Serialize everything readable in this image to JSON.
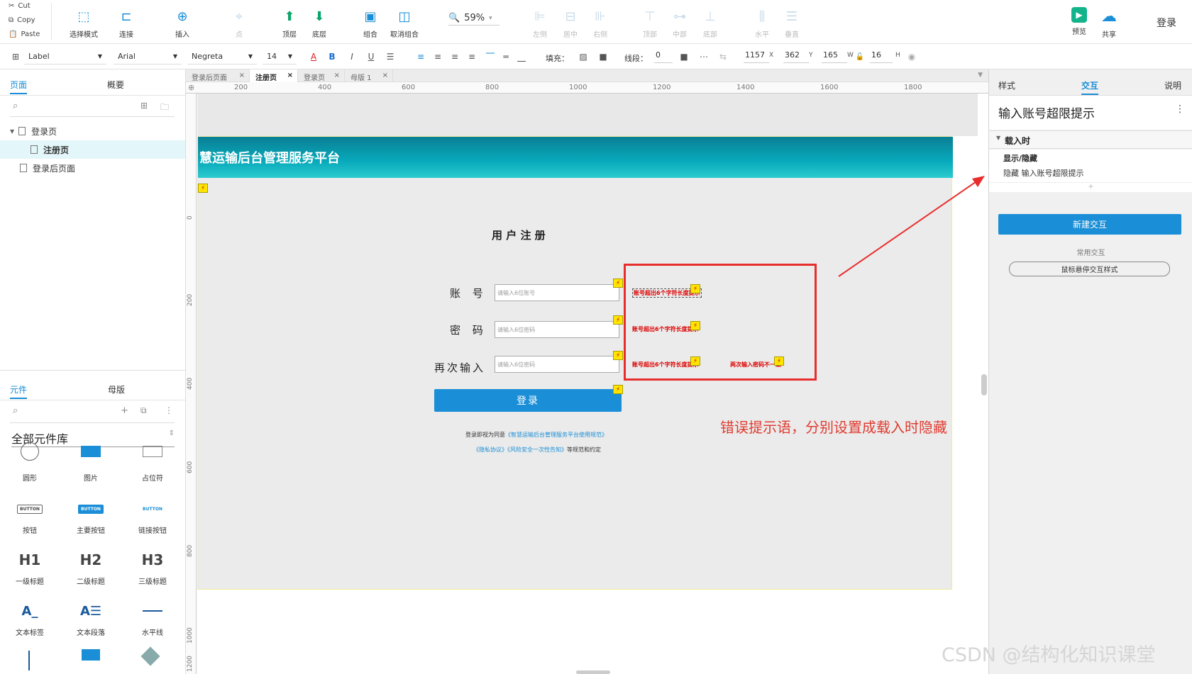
{
  "clipboard": {
    "cut": "Cut",
    "copy": "Copy",
    "paste": "Paste"
  },
  "toolbar": {
    "select_mode": "选择模式",
    "connect": "连接",
    "insert": "插入",
    "point": "点",
    "top_layer": "顶层",
    "bottom_layer": "底层",
    "group": "组合",
    "ungroup": "取消组合",
    "zoom": "59%",
    "align_left": "左侧",
    "align_center": "居中",
    "align_right": "右侧",
    "align_top": "顶部",
    "align_middle": "中部",
    "align_bottom": "底部",
    "dist_h": "水平",
    "dist_v": "垂直",
    "preview": "预览",
    "share": "共享",
    "login": "登录"
  },
  "format": {
    "style": "Label",
    "font": "Arial",
    "weight": "Negreta",
    "size": "14",
    "fill_label": "填充：",
    "line_label": "线段：",
    "line_value": "0",
    "x": "1157",
    "y": "362",
    "w": "165",
    "h": "16",
    "x_unit": "X",
    "y_unit": "Y",
    "w_unit": "W",
    "h_unit": "H"
  },
  "left": {
    "tab_pages": "页面",
    "tab_outline": "概要",
    "pages": [
      "登录页",
      "注册页",
      "登录后页面"
    ],
    "tab_widgets": "元件",
    "tab_masters": "母版",
    "library": "全部元件库",
    "widgets": [
      "圆形",
      "图片",
      "占位符",
      "按钮",
      "主要按钮",
      "链接按钮",
      "一级标题",
      "二级标题",
      "三级标题",
      "文本标签",
      "文本段落",
      "水平线"
    ],
    "widget_glyphs": {
      "button": "BUTTON",
      "h1": "H1",
      "h2": "H2",
      "h3": "H3"
    }
  },
  "doc_tabs": [
    "登录后页面",
    "注册页",
    "登录页",
    "母版 1"
  ],
  "ruler": [
    "200",
    "400",
    "600",
    "800",
    "1000",
    "1200",
    "1400",
    "1600",
    "1800"
  ],
  "vruler": [
    "0",
    "200",
    "400",
    "600",
    "800",
    "1000",
    "1200"
  ],
  "page": {
    "banner": "慧运输后台管理服务平台",
    "form_title": "用 户 注 册",
    "labels": [
      "账 号",
      "密 码",
      "再次输入"
    ],
    "placeholders": [
      "请输入6位账号",
      "请输入6位密码",
      "请输入6位密码"
    ],
    "errors": [
      "账号超出6个字符长度提示",
      "账号超出6个字符长度提示",
      "账号超出6个字符长度提示",
      "两次输入密码不一致"
    ],
    "login_button": "登录",
    "agree1_a": "登录即视为同意",
    "agree1_b": "《智慧运输后台管理服务平台使用规范》",
    "agree2_a": "《隐私协议》《风险安全一次性告知》",
    "agree2_b": "等规范和约定",
    "bolt": "⚡"
  },
  "annotation": "错误提示语，分别设置成载入时隐藏",
  "watermark": "CSDN @结构化知识课堂",
  "right": {
    "tab_style": "样式",
    "tab_interact": "交互",
    "tab_notes": "说明",
    "widget_name": "输入账号超限提示",
    "event": "载入时",
    "action": "显示/隐藏",
    "action_detail": "隐藏 输入账号超限提示",
    "new_interaction": "新建交互",
    "common": "常用交互",
    "hover": "鼠标悬停交互样式"
  }
}
